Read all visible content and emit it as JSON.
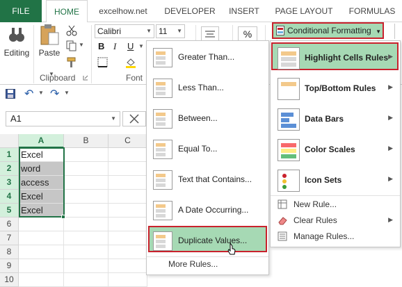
{
  "tabs": {
    "file": "FILE",
    "home": "HOME",
    "excelhow": "excelhow.net",
    "developer": "DEVELOPER",
    "insert": "INSERT",
    "page_layout": "PAGE LAYOUT",
    "formulas": "FORMULAS"
  },
  "ribbon": {
    "editing_label": "Editing",
    "paste_label": "Paste",
    "clipboard_group": "Clipboard",
    "font_group": "Font",
    "font_name": "Calibri",
    "font_size": "11",
    "bold": "B",
    "italic": "I",
    "underline": "U",
    "conditional_formatting": "Conditional Formatting"
  },
  "namebox": {
    "value": "A1"
  },
  "grid": {
    "columns": [
      "A",
      "B",
      "C"
    ],
    "rows": [
      "1",
      "2",
      "3",
      "4",
      "5",
      "6",
      "7",
      "8",
      "9",
      "10"
    ],
    "cells_a": [
      "Excel",
      "word",
      "access",
      "Excel",
      "Excel"
    ]
  },
  "highlight_menu": {
    "items": [
      "Greater Than...",
      "Less Than...",
      "Between...",
      "Equal To...",
      "Text that Contains...",
      "A Date Occurring...",
      "Duplicate Values..."
    ],
    "more_rules": "More Rules..."
  },
  "cf_menu": {
    "items": [
      "Highlight Cells Rules",
      "Top/Bottom Rules",
      "Data Bars",
      "Color Scales",
      "Icon Sets"
    ],
    "new_rule": "New Rule...",
    "clear_rules": "Clear Rules",
    "manage_rules": "Manage Rules..."
  },
  "colors": {
    "excel_green": "#217346",
    "highlight_green": "#a6d9b4",
    "annotation_red": "#c9222d"
  }
}
